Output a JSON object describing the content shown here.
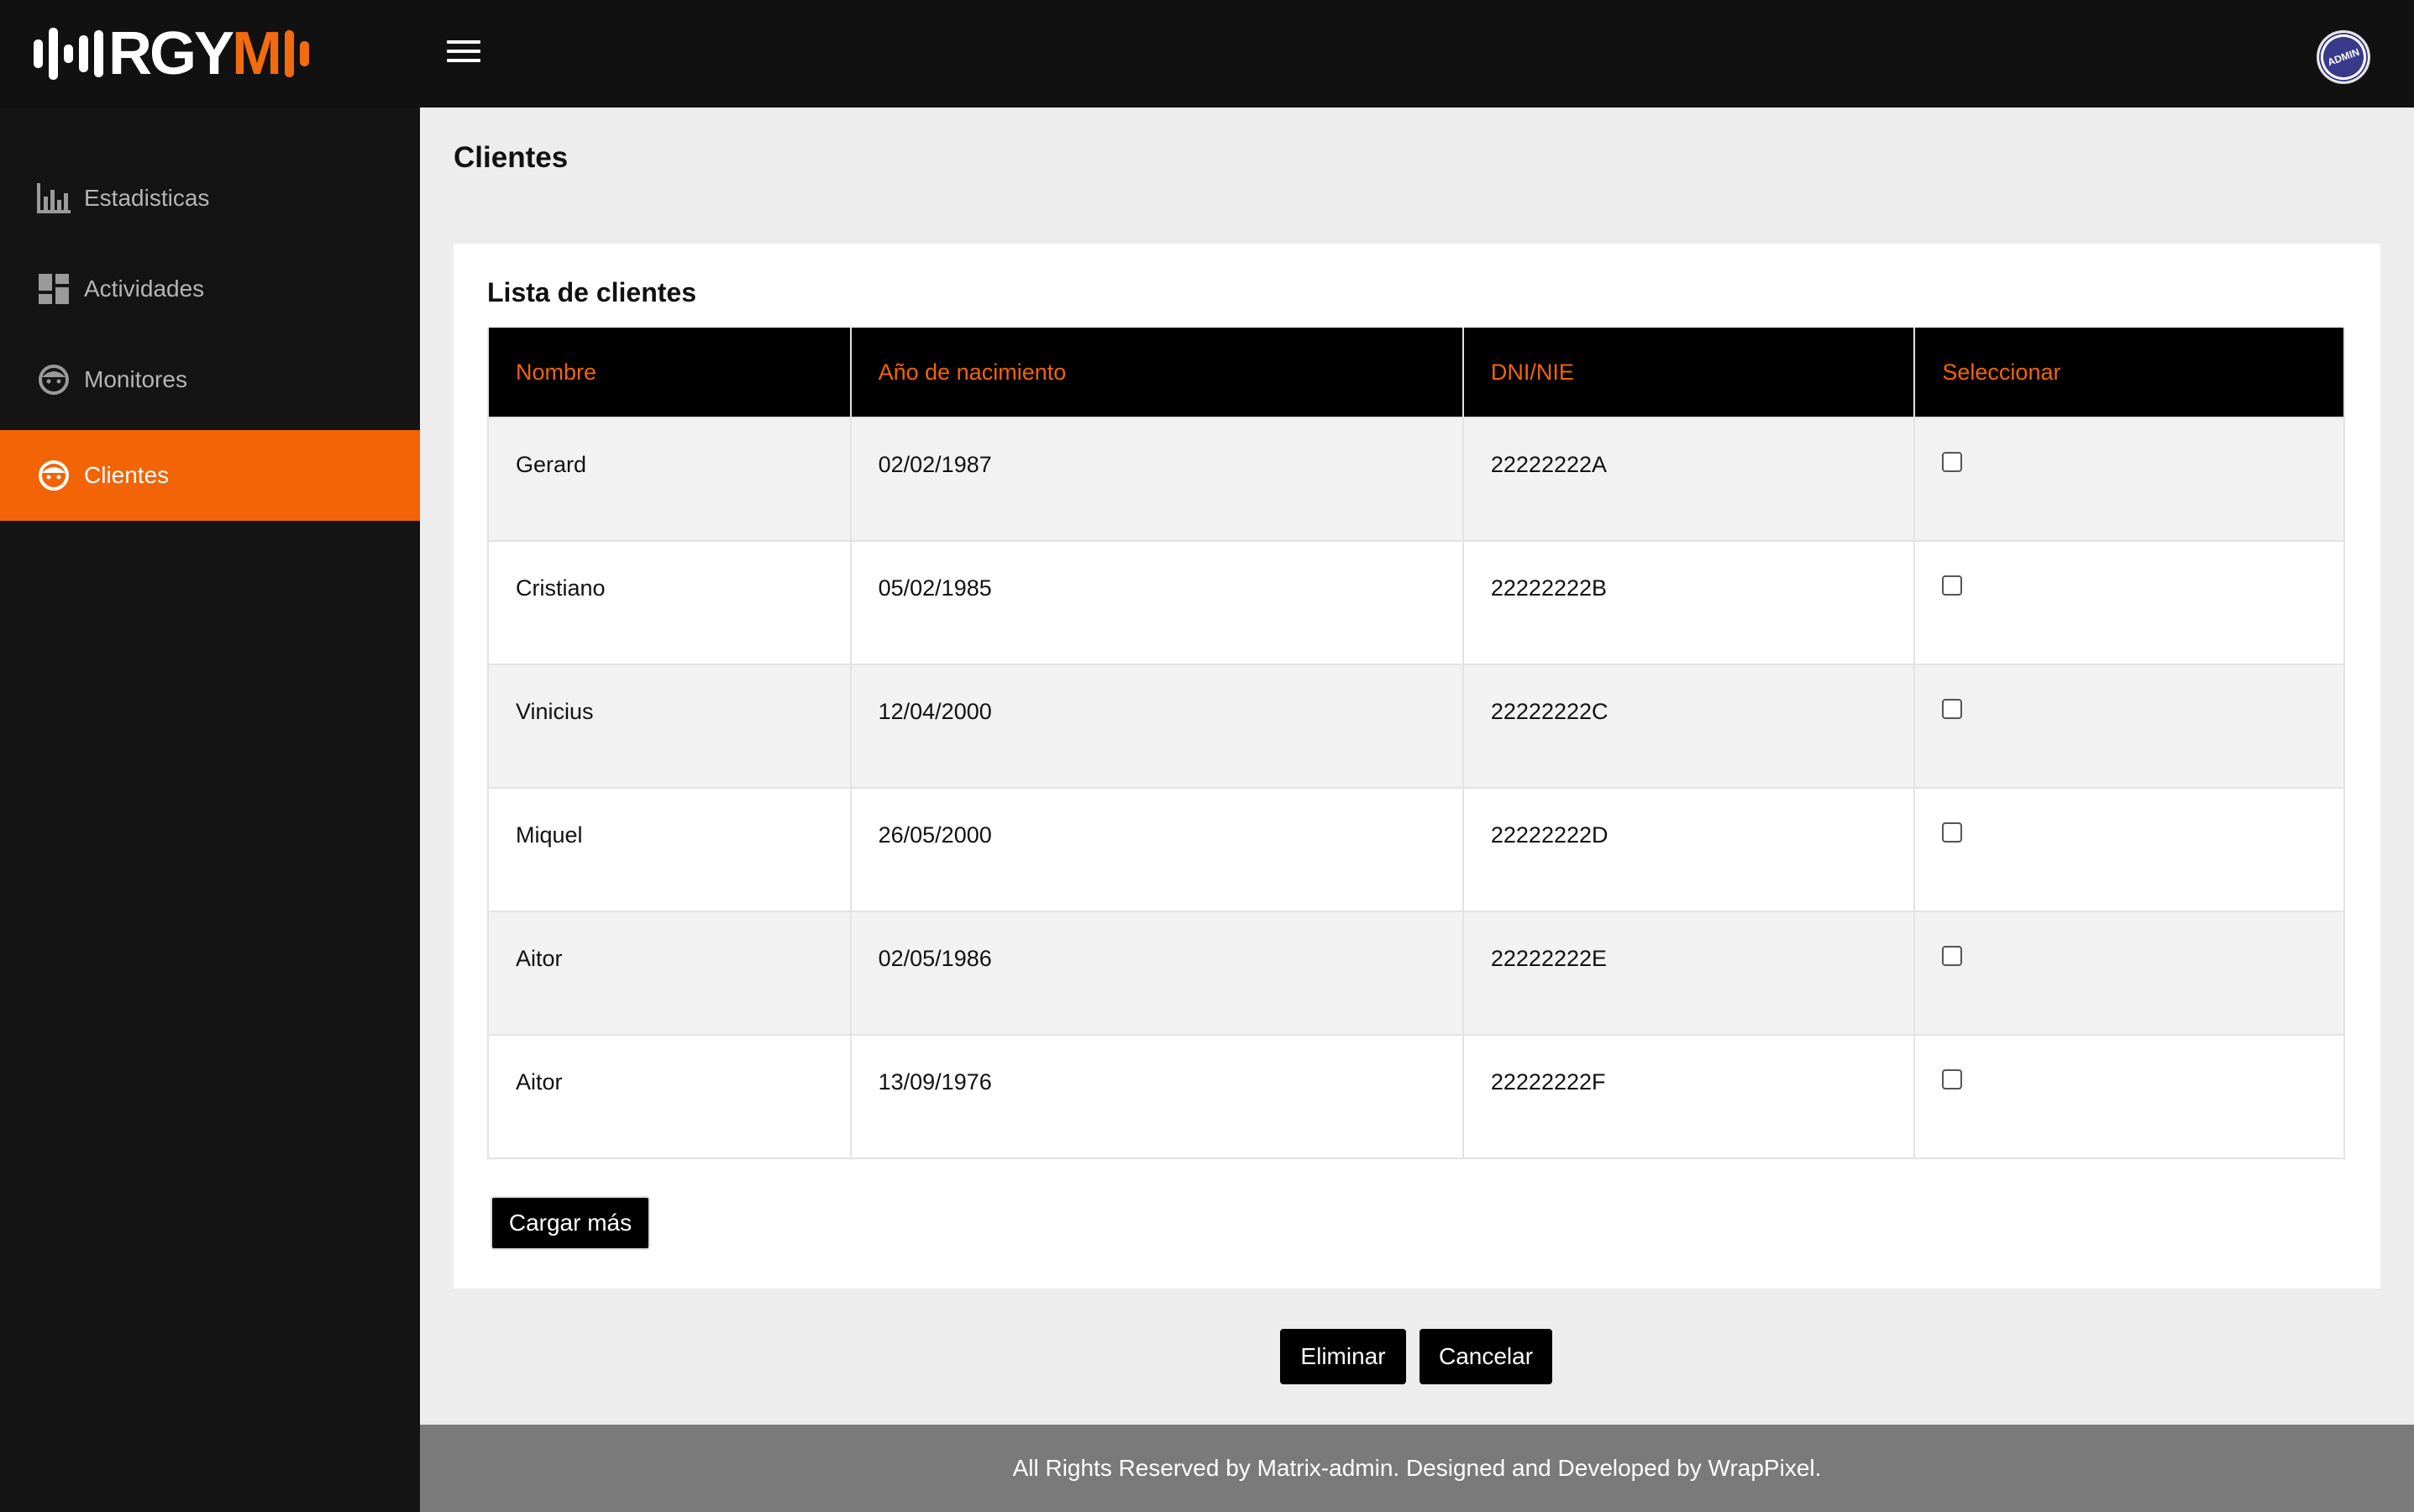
{
  "brand": {
    "logo_text_white": "RGY",
    "logo_text_orange": "M",
    "accent": "#f26405"
  },
  "topbar": {
    "menu_icon": "hamburger-menu-icon",
    "avatar_text": "ADMIN"
  },
  "sidebar": {
    "items": [
      {
        "label": "Estadisticas",
        "icon": "bar-chart-icon",
        "active": false
      },
      {
        "label": "Actividades",
        "icon": "dashboard-grid-icon",
        "active": false
      },
      {
        "label": "Monitores",
        "icon": "face-icon",
        "active": false
      },
      {
        "label": "Clientes",
        "icon": "face-icon",
        "active": true
      }
    ]
  },
  "page": {
    "title": "Clientes"
  },
  "card": {
    "title": "Lista de clientes",
    "columns": [
      "Nombre",
      "Año de nacimiento",
      "DNI/NIE",
      "Seleccionar"
    ],
    "rows": [
      {
        "name": "Gerard",
        "birth": "02/02/1987",
        "dni": "22222222A",
        "selected": false
      },
      {
        "name": "Cristiano",
        "birth": "05/02/1985",
        "dni": "22222222B",
        "selected": false
      },
      {
        "name": "Vinicius",
        "birth": "12/04/2000",
        "dni": "22222222C",
        "selected": false
      },
      {
        "name": "Miquel",
        "birth": "26/05/2000",
        "dni": "22222222D",
        "selected": false
      },
      {
        "name": "Aitor",
        "birth": "02/05/1986",
        "dni": "22222222E",
        "selected": false
      },
      {
        "name": "Aitor",
        "birth": "13/09/1976",
        "dni": "22222222F",
        "selected": false
      }
    ],
    "load_more_label": "Cargar más"
  },
  "actions": {
    "delete_label": "Eliminar",
    "cancel_label": "Cancelar"
  },
  "footer": {
    "text": "All Rights Reserved by Matrix-admin. Designed and Developed by WrapPixel."
  }
}
